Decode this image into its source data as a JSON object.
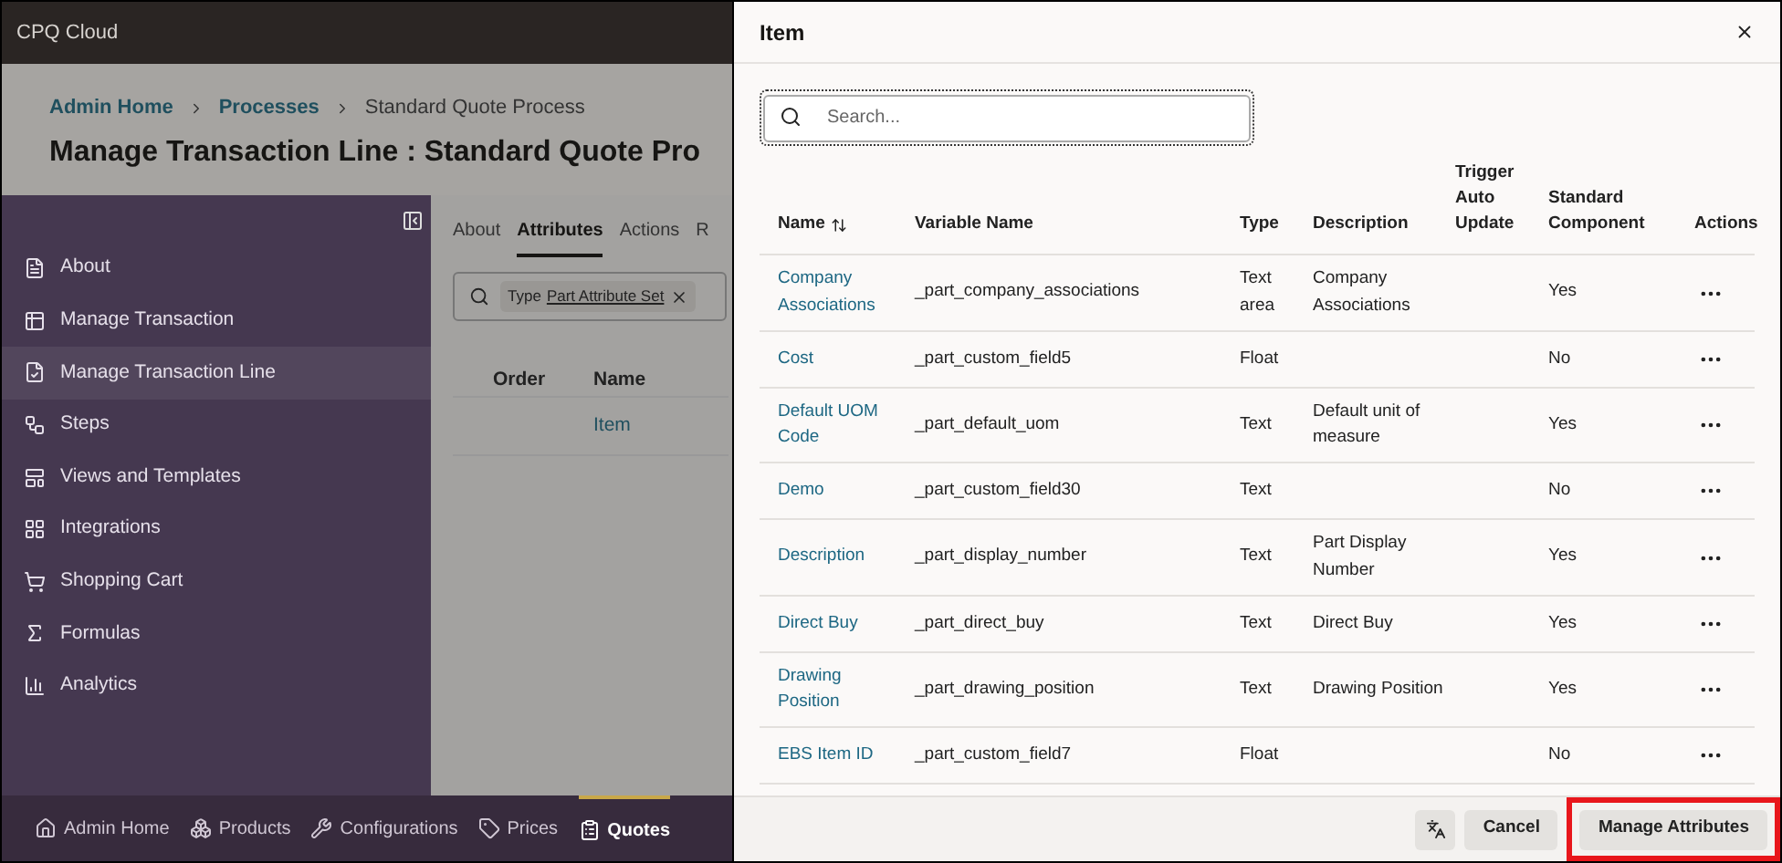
{
  "app_bar": {
    "title": "CPQ Cloud"
  },
  "breadcrumbs": [
    {
      "label": "Admin Home",
      "link": true
    },
    {
      "label": "Processes",
      "link": true
    },
    {
      "label": "Standard Quote Process",
      "link": false
    }
  ],
  "page_title": "Manage Transaction Line : Standard Quote Pro",
  "sidebar": {
    "items": [
      {
        "label": "About",
        "selected": false
      },
      {
        "label": "Manage Transaction",
        "selected": false
      },
      {
        "label": "Manage Transaction Line",
        "selected": true
      },
      {
        "label": "Steps",
        "selected": false
      },
      {
        "label": "Views and Templates",
        "selected": false
      },
      {
        "label": "Integrations",
        "selected": false
      },
      {
        "label": "Shopping Cart",
        "selected": false
      },
      {
        "label": "Formulas",
        "selected": false
      },
      {
        "label": "Analytics",
        "selected": false
      }
    ]
  },
  "tabs": [
    {
      "label": "About",
      "selected": false
    },
    {
      "label": "Attributes",
      "selected": true
    },
    {
      "label": "Actions",
      "selected": false
    },
    {
      "label": "R",
      "selected": false
    }
  ],
  "filter": {
    "label": "Type",
    "value": "Part Attribute Set"
  },
  "bg_table": {
    "columns": [
      "Order",
      "Name"
    ],
    "rows": [
      {
        "name": "Item"
      }
    ]
  },
  "bottom_nav": [
    {
      "label": "Admin Home",
      "selected": false
    },
    {
      "label": "Products",
      "selected": false
    },
    {
      "label": "Configurations",
      "selected": false
    },
    {
      "label": "Prices",
      "selected": false
    },
    {
      "label": "Quotes",
      "selected": true
    }
  ],
  "dialog": {
    "title": "Item",
    "search": {
      "placeholder": "Search..."
    },
    "columns": [
      "Name",
      "Variable Name",
      "Type",
      "Description",
      "Trigger Auto Update",
      "Standard Component",
      "Actions"
    ],
    "rows": [
      {
        "name": "Company Associations",
        "variable": "_part_company_associations",
        "type": "Text area",
        "description": "Company Associations",
        "standard": "Yes"
      },
      {
        "name": "Cost",
        "variable": "_part_custom_field5",
        "type": "Float",
        "description": "",
        "standard": "No"
      },
      {
        "name": "Default UOM Code",
        "variable": "_part_default_uom",
        "type": "Text",
        "description": "Default unit of measure",
        "standard": "Yes"
      },
      {
        "name": "Demo",
        "variable": "_part_custom_field30",
        "type": "Text",
        "description": "",
        "standard": "No"
      },
      {
        "name": "Description",
        "variable": "_part_display_number",
        "type": "Text",
        "description": "Part Display Number",
        "standard": "Yes"
      },
      {
        "name": "Direct Buy",
        "variable": "_part_direct_buy",
        "type": "Text",
        "description": "Direct Buy",
        "standard": "Yes"
      },
      {
        "name": "Drawing Position",
        "variable": "_part_drawing_position",
        "type": "Text",
        "description": "Drawing Position",
        "standard": "Yes"
      },
      {
        "name": "EBS Item ID",
        "variable": "_part_custom_field7",
        "type": "Float",
        "description": "",
        "standard": "No"
      }
    ],
    "buttons": [
      {
        "label": "Cancel",
        "highlighted": false
      },
      {
        "label": "Manage Attributes",
        "highlighted": true
      }
    ]
  }
}
